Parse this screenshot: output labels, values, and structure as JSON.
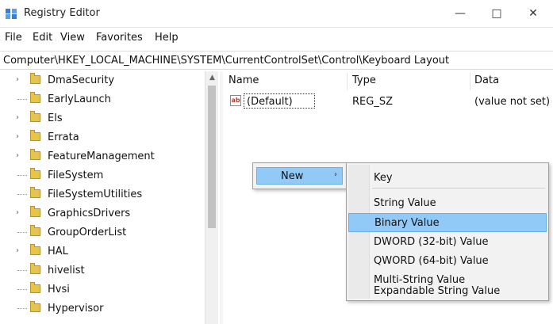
{
  "window": {
    "title": "Registry Editor",
    "controls": [
      "—",
      "□",
      "✕"
    ]
  },
  "menu": [
    "File",
    "Edit",
    "View",
    "Favorites",
    "Help"
  ],
  "address": "Computer\\HKEY_LOCAL_MACHINE\\SYSTEM\\CurrentControlSet\\Control\\Keyboard Layout",
  "tree": [
    {
      "label": "DmaSecurity",
      "expander": "›"
    },
    {
      "label": "EarlyLaunch",
      "expander": ""
    },
    {
      "label": "Els",
      "expander": "›"
    },
    {
      "label": "Errata",
      "expander": "›"
    },
    {
      "label": "FeatureManagement",
      "expander": "›"
    },
    {
      "label": "FileSystem",
      "expander": ""
    },
    {
      "label": "FileSystemUtilities",
      "expander": ""
    },
    {
      "label": "GraphicsDrivers",
      "expander": "›"
    },
    {
      "label": "GroupOrderList",
      "expander": ""
    },
    {
      "label": "HAL",
      "expander": "›"
    },
    {
      "label": "hivelist",
      "expander": ""
    },
    {
      "label": "Hvsi",
      "expander": ""
    },
    {
      "label": "Hypervisor",
      "expander": ""
    }
  ],
  "list": {
    "headers": {
      "name": "Name",
      "type": "Type",
      "data": "Data"
    },
    "rows": [
      {
        "name": "(Default)",
        "type": "REG_SZ",
        "data": "(value not set)",
        "icon": "ab"
      }
    ]
  },
  "context_menu": {
    "new_label": "New",
    "arrow": "›"
  },
  "submenu": {
    "items": [
      "Key",
      "String Value",
      "Binary Value",
      "DWORD (32-bit) Value",
      "QWORD (64-bit) Value",
      "Multi-String Value",
      "Expandable String Value"
    ]
  },
  "colors": {
    "highlight": "#91c9f7",
    "folder": "#e8c44d"
  }
}
